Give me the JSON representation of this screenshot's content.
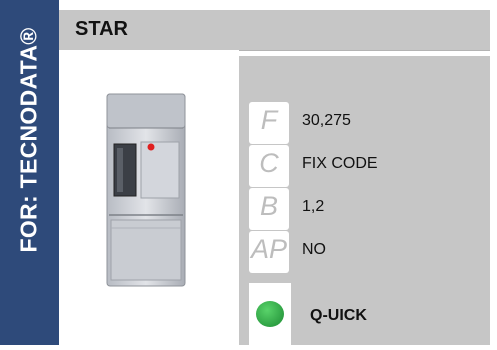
{
  "sidebar": {
    "brand_text": "FOR: TECNODATA®"
  },
  "header": {
    "title": "STAR"
  },
  "specs": [
    {
      "code": "F",
      "value": "30,275"
    },
    {
      "code": "C",
      "value": "FIX CODE"
    },
    {
      "code": "B",
      "value": "1,2"
    },
    {
      "code": "AP",
      "value": "NO"
    }
  ],
  "status": {
    "label": "Q-UICK",
    "led_color": "#2ea043"
  },
  "product": {
    "name": "remote-control"
  }
}
